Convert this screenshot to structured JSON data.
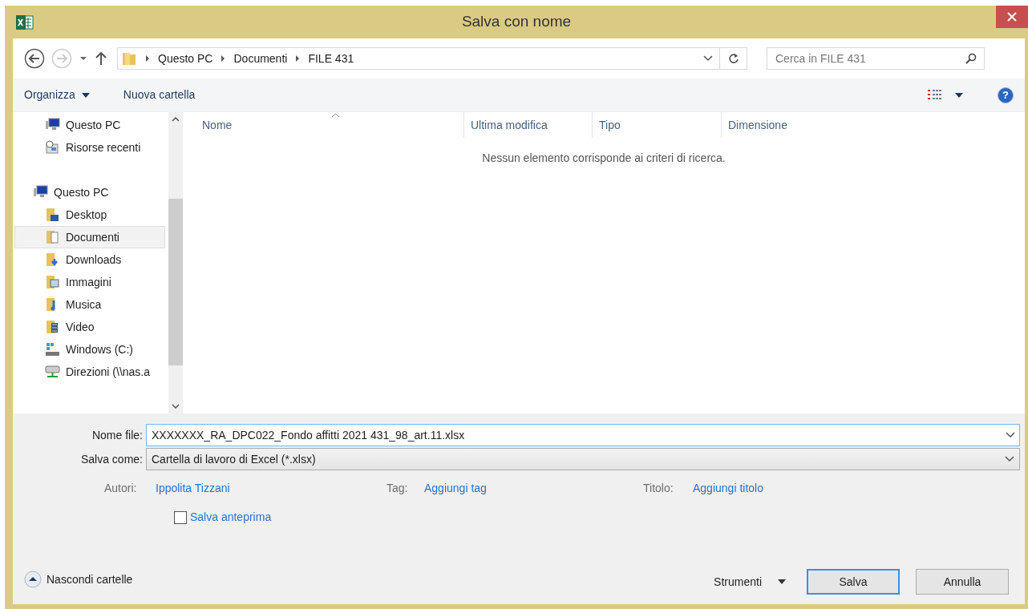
{
  "window": {
    "title": "Salva con nome"
  },
  "address_bar": {
    "path": [
      "Questo PC",
      "Documenti",
      "FILE 431"
    ]
  },
  "search": {
    "placeholder": "Cerca in FILE 431"
  },
  "toolbar": {
    "organize": "Organizza",
    "new_folder": "Nuova cartella",
    "help": "?"
  },
  "sidebar": {
    "favorites": [
      {
        "label": "Questo PC",
        "kind": "pc",
        "selected": false
      },
      {
        "label": "Risorse recenti",
        "kind": "recent",
        "selected": false
      }
    ],
    "this_pc": {
      "label": "Questo PC",
      "kind": "pc",
      "selected": false,
      "children": [
        {
          "label": "Desktop",
          "kind": "desktop",
          "selected": false
        },
        {
          "label": "Documenti",
          "kind": "documents",
          "selected": true
        },
        {
          "label": "Downloads",
          "kind": "downloads",
          "selected": false
        },
        {
          "label": "Immagini",
          "kind": "pictures",
          "selected": false
        },
        {
          "label": "Musica",
          "kind": "music",
          "selected": false
        },
        {
          "label": "Video",
          "kind": "video",
          "selected": false
        },
        {
          "label": "Windows (C:)",
          "kind": "drive",
          "selected": false
        },
        {
          "label": "Direzioni (\\\\nas.a",
          "kind": "network",
          "selected": false
        }
      ]
    }
  },
  "table": {
    "columns": [
      "Nome",
      "Ultima modifica",
      "Tipo",
      "Dimensione"
    ],
    "empty_message": "Nessun elemento corrisponde ai criteri di ricerca."
  },
  "form": {
    "file_name_label": "Nome file:",
    "file_name": "XXXXXXX_RA_DPC022_Fondo affitti 2021 431_98_art.11.xlsx",
    "save_as_label": "Salva come:",
    "save_as": "Cartella di lavoro di Excel (*.xlsx)",
    "meta": [
      {
        "label": "Autori:",
        "value": "Ippolita Tizzani"
      },
      {
        "label": "Tag:",
        "value": "Aggiungi tag"
      },
      {
        "label": "Titolo:",
        "value": "Aggiungi titolo"
      }
    ],
    "thumbnail": {
      "label": "Salva anteprima",
      "checked": false
    }
  },
  "footer": {
    "hide_folders": "Nascondi cartelle",
    "tools": "Strumenti",
    "buttons": [
      "Salva",
      "Annulla"
    ]
  }
}
